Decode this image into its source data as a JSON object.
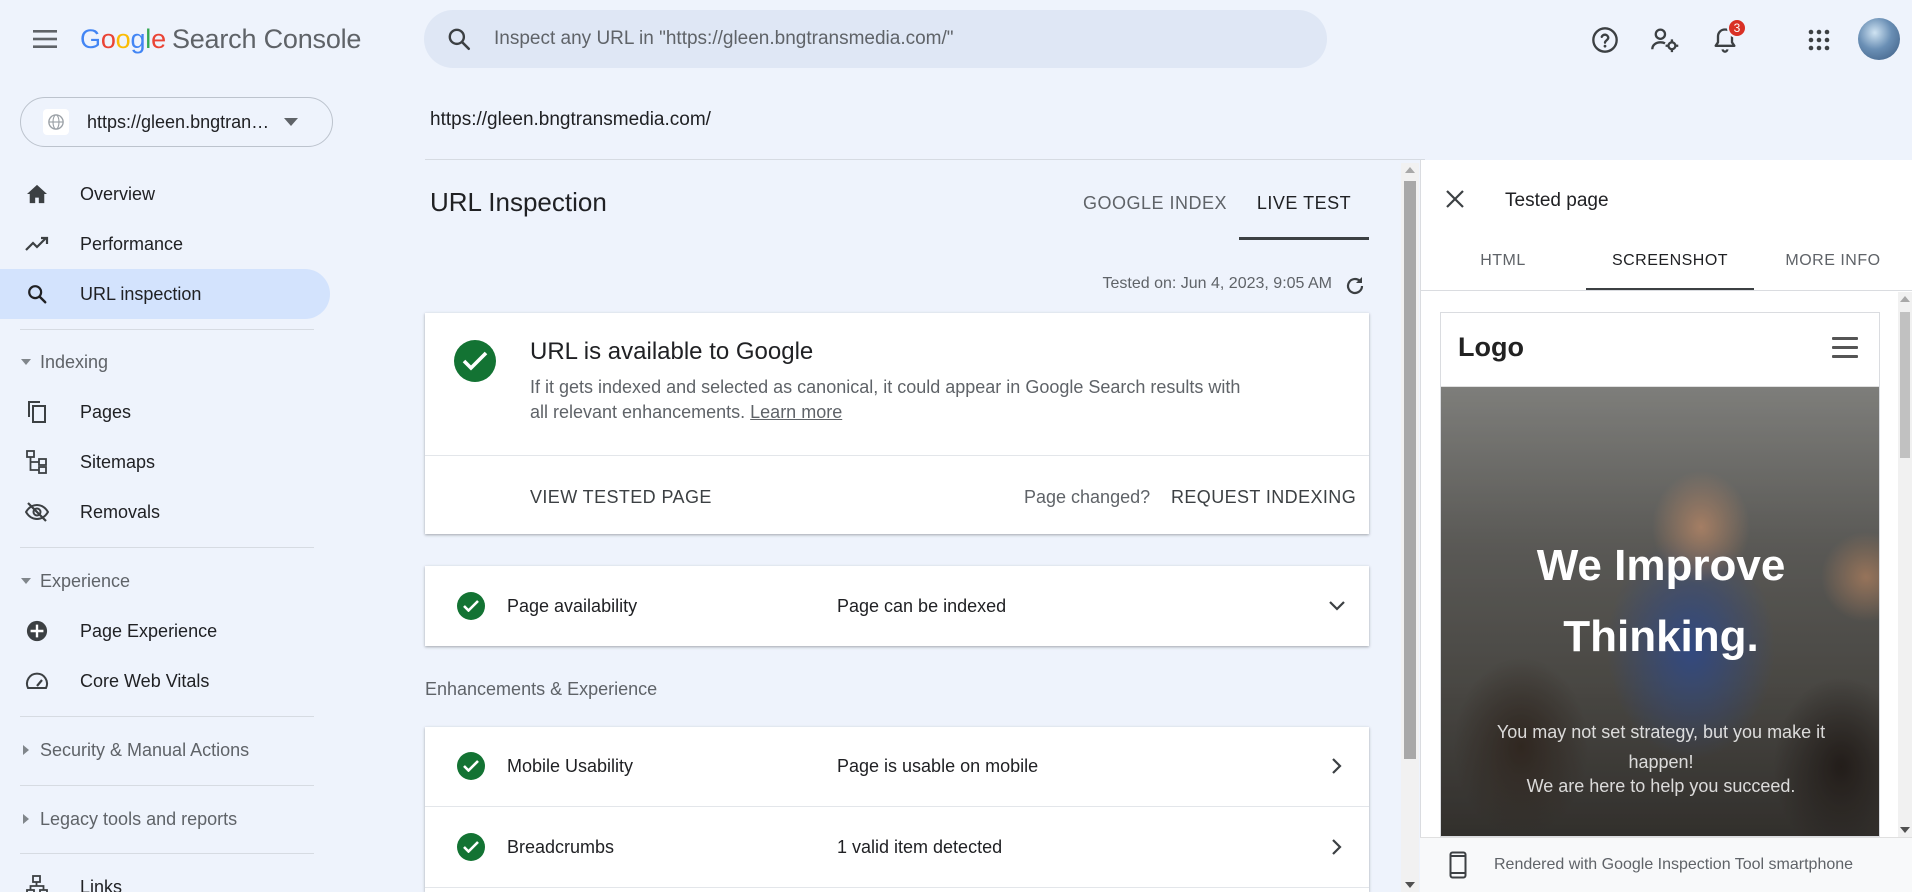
{
  "app": {
    "logo_letters": [
      "G",
      "o",
      "o",
      "g",
      "l",
      "e"
    ],
    "product": "Search Console"
  },
  "search": {
    "placeholder": "Inspect any URL in \"https://gleen.bngtransmedia.com/\""
  },
  "header_icons": {
    "help": "help-icon",
    "users": "manage-users-icon",
    "notifications": "bell-icon",
    "notification_count": "3",
    "apps": "apps-grid-icon"
  },
  "property": {
    "label": "https://gleen.bngtransmedia.com/"
  },
  "sidebar": {
    "items": [
      {
        "label": "Overview",
        "icon": "home-icon"
      },
      {
        "label": "Performance",
        "icon": "trending-up-icon"
      },
      {
        "label": "URL inspection",
        "icon": "search-icon"
      }
    ],
    "indexing": {
      "heading": "Indexing",
      "items": [
        {
          "label": "Pages",
          "icon": "pages-icon"
        },
        {
          "label": "Sitemaps",
          "icon": "sitemap-icon"
        },
        {
          "label": "Removals",
          "icon": "removals-icon"
        }
      ]
    },
    "experience": {
      "heading": "Experience",
      "items": [
        {
          "label": "Page Experience",
          "icon": "page-experience-icon"
        },
        {
          "label": "Core Web Vitals",
          "icon": "speed-gauge-icon"
        }
      ]
    },
    "security": "Security & Manual Actions",
    "legacy": "Legacy tools and reports",
    "links": "Links"
  },
  "main": {
    "url": "https://gleen.bngtransmedia.com/",
    "title": "URL Inspection",
    "tabs": [
      "GOOGLE INDEX",
      "LIVE TEST"
    ],
    "active_tab": "LIVE TEST",
    "tested_on": "Tested on: Jun 4, 2023, 9:05 AM",
    "status": {
      "title": "URL is available to Google",
      "desc": "If it gets indexed and selected as canonical, it could appear in Google Search results with all relevant enhancements.",
      "learn_more": "Learn more",
      "view_tested": "VIEW TESTED PAGE",
      "page_changed": "Page changed?",
      "request_indexing": "REQUEST INDEXING"
    },
    "availability": {
      "label": "Page availability",
      "value": "Page can be indexed"
    },
    "enhancements_heading": "Enhancements & Experience",
    "enhancements": [
      {
        "label": "Mobile Usability",
        "value": "Page is usable on mobile"
      },
      {
        "label": "Breadcrumbs",
        "value": "1 valid item detected"
      }
    ]
  },
  "panel": {
    "title": "Tested page",
    "tabs": [
      "HTML",
      "SCREENSHOT",
      "MORE INFO"
    ],
    "active_tab": "SCREENSHOT",
    "screenshot": {
      "logo": "Logo",
      "headline_1": "We Improve",
      "headline_2": "Thinking.",
      "sub": "You may not set strategy, but you make it happen!",
      "sub2": "We are here to help you succeed."
    },
    "footer": "Rendered with Google Inspection Tool smartphone"
  },
  "colors": {
    "background": "#eef3fc",
    "active_nav": "#d3e3fd",
    "success": "#137333"
  }
}
